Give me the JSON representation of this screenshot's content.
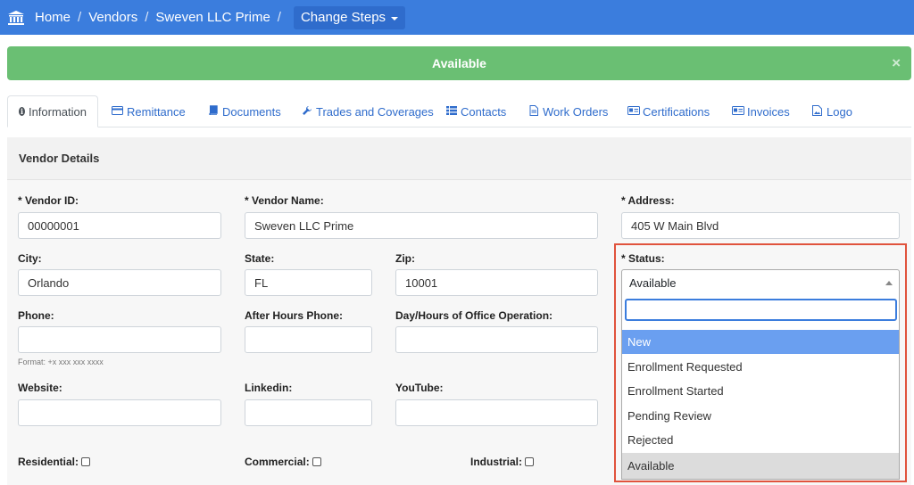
{
  "breadcrumb": {
    "items": [
      "Home",
      "Vendors",
      "Sweven LLC Prime"
    ],
    "separator": "/",
    "change_steps": "Change Steps"
  },
  "alert": {
    "text": "Available",
    "close": "×"
  },
  "tabs": [
    {
      "label": "Information",
      "icon": "info-icon"
    },
    {
      "label": "Remittance",
      "icon": "credit-card-icon"
    },
    {
      "label": "Documents",
      "icon": "book-icon"
    },
    {
      "label": "Trades and Coverages",
      "icon": "wrench-icon"
    },
    {
      "label": "Contacts",
      "icon": "list-icon"
    },
    {
      "label": "Work Orders",
      "icon": "file-icon"
    },
    {
      "label": "Certifications",
      "icon": "id-card-icon"
    },
    {
      "label": "Invoices",
      "icon": "id-card-icon"
    },
    {
      "label": "Logo",
      "icon": "image-icon"
    }
  ],
  "panel": {
    "title": "Vendor Details"
  },
  "form": {
    "vendor_id": {
      "label": "* Vendor ID:",
      "value": "00000001"
    },
    "vendor_name": {
      "label": "* Vendor Name:",
      "value": "Sweven LLC Prime"
    },
    "address": {
      "label": "* Address:",
      "value": "405 W Main Blvd"
    },
    "city": {
      "label": "City:",
      "value": "Orlando"
    },
    "state": {
      "label": "State:",
      "value": "FL"
    },
    "zip": {
      "label": "Zip:",
      "value": "10001"
    },
    "status": {
      "label": "* Status:",
      "value": "Available"
    },
    "phone": {
      "label": "Phone:",
      "value": "",
      "hint": "Format: +x xxx xxx xxxx"
    },
    "after_hours_phone": {
      "label": "After Hours Phone:",
      "value": ""
    },
    "office_hours": {
      "label": "Day/Hours of Office Operation:",
      "value": ""
    },
    "website": {
      "label": "Website:",
      "value": ""
    },
    "linkedin": {
      "label": "Linkedin:",
      "value": ""
    },
    "youtube": {
      "label": "YouTube:",
      "value": ""
    },
    "residential": {
      "label": "Residential:",
      "checked": false
    },
    "commercial": {
      "label": "Commercial:",
      "checked": false
    },
    "industrial": {
      "label": "Industrial:",
      "checked": false
    }
  },
  "status_dropdown": {
    "search_value": "",
    "options": [
      "New",
      "Enrollment Requested",
      "Enrollment Started",
      "Pending Review",
      "Rejected",
      "Available"
    ],
    "highlighted": "New",
    "selected": "Available"
  },
  "colors": {
    "navbar": "#3b7ddd",
    "alert_success": "#6abf73",
    "link": "#2f6ccc",
    "highlight_box": "#e0533d",
    "option_highlight": "#6a9ff0"
  }
}
